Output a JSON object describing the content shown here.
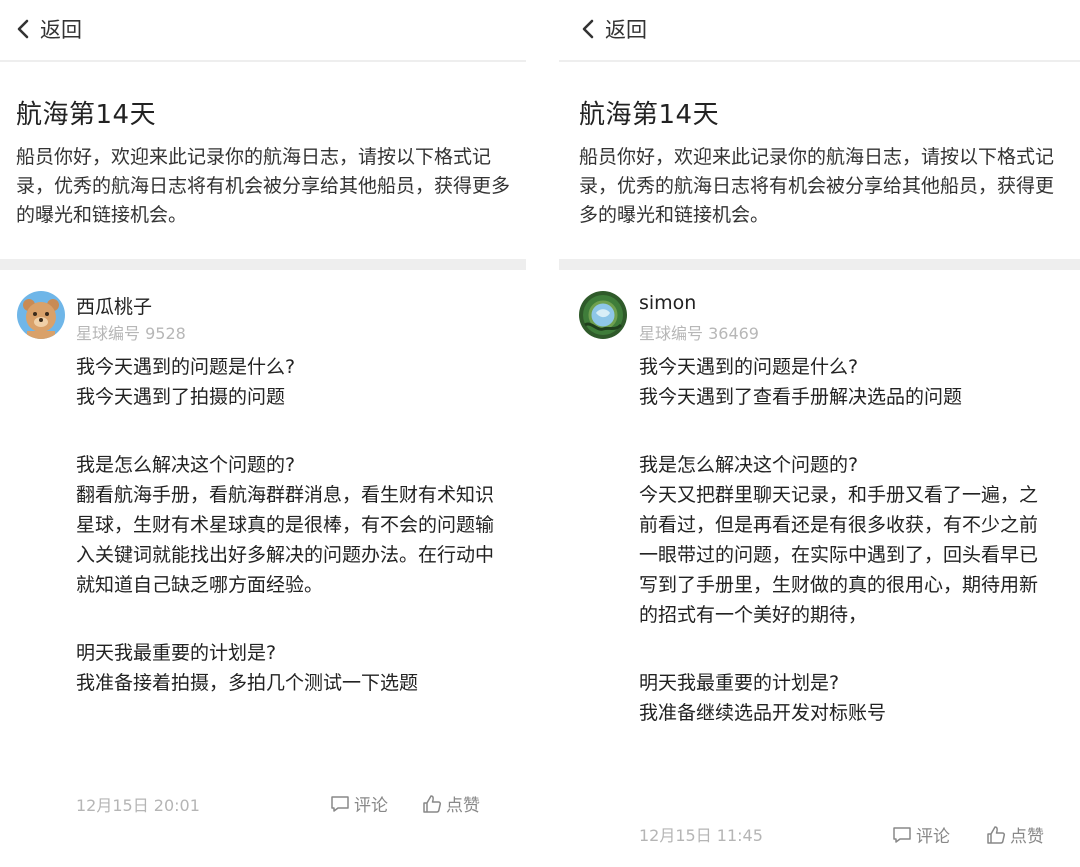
{
  "left": {
    "back_label": "返回",
    "title": "航海第14天",
    "description": "船员你好，欢迎来此记录你的航海日志，请按以下格式记录，优秀的航海日志将有机会被分享给其他船员，获得更多的曝光和链接机会。",
    "user": {
      "name": "西瓜桃子",
      "member_id": "星球编号 9528",
      "avatar": "bear-avatar"
    },
    "entry": {
      "q1": "我今天遇到的问题是什么?",
      "a1": "我今天遇到了拍摄的问题",
      "q2": "我是怎么解决这个问题的?",
      "a2": "翻看航海手册，看航海群群消息，看生财有术知识星球，生财有术星球真的是很棒，有不会的问题输入关键词就能找出好多解决的问题办法。在行动中就知道自己缺乏哪方面经验。",
      "q3": "明天我最重要的计划是?",
      "a3": "我准备接着拍摄，多拍几个测试一下选题"
    },
    "timestamp": "12月15日 20:01",
    "comment_label": "评论",
    "like_label": "点赞"
  },
  "right": {
    "back_label": "返回",
    "title": "航海第14天",
    "description": "船员你好，欢迎来此记录你的航海日志，请按以下格式记录，优秀的航海日志将有机会被分享给其他船员，获得更多的曝光和链接机会。",
    "user": {
      "name": "simon",
      "member_id": "星球编号 36469",
      "avatar": "globe-avatar"
    },
    "entry": {
      "q1": "我今天遇到的问题是什么?",
      "a1": "我今天遇到了查看手册解决选品的问题",
      "q2": "我是怎么解决这个问题的?",
      "a2": "今天又把群里聊天记录，和手册又看了一遍，之前看过，但是再看还是有很多收获，有不少之前一眼带过的问题，在实际中遇到了，回头看早已写到了手册里，生财做的真的很用心，期待用新的招式有一个美好的期待，",
      "q3": "明天我最重要的计划是?",
      "a3": "我准备继续选品开发对标账号"
    },
    "timestamp": "12月15日 11:45",
    "comment_label": "评论",
    "like_label": "点赞"
  },
  "colors": {
    "divider": "#eeeeee",
    "muted": "#b5b5b5",
    "text": "#222222"
  }
}
